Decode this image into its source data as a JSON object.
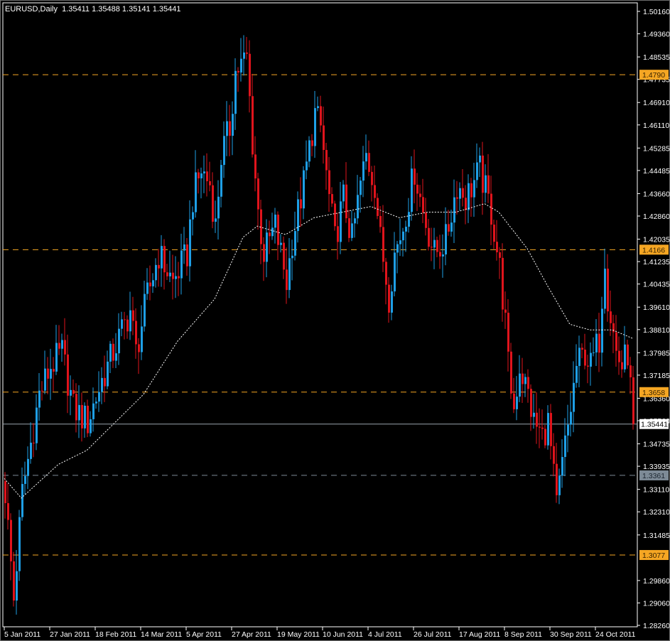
{
  "header": {
    "symbol_period": "EURUSD,Daily",
    "ohlc": "1.35411 1.35488 1.35141 1.35441"
  },
  "colors": {
    "background": "#000000",
    "bull": "#1e9fe6",
    "bear": "#e0141c",
    "grid_axis": "#ffffff",
    "level_orange": "#f5a623",
    "level_gray": "#7d8a96",
    "moving_average": "#ffffff"
  },
  "chart_data": {
    "type": "candlestick",
    "title": "EURUSD,Daily",
    "ylim": [
      1.2826,
      1.5016
    ],
    "y_ticks": [
      "1.50160",
      "1.49360",
      "1.48535",
      "1.47735",
      "1.46910",
      "1.46110",
      "1.45285",
      "1.44485",
      "1.43660",
      "1.42860",
      "1.42035",
      "1.41235",
      "1.40435",
      "1.39610",
      "1.38810",
      "1.37985",
      "1.37185",
      "1.36360",
      "1.35560",
      "1.34735",
      "1.33935",
      "1.33110",
      "1.32310",
      "1.31485",
      "1.29860",
      "1.29060",
      "1.28260"
    ],
    "x_ticks": [
      {
        "bar": 0,
        "label": "5 Jan 2011"
      },
      {
        "bar": 16,
        "label": "27 Jan 2011"
      },
      {
        "bar": 32,
        "label": "18 Feb 2011"
      },
      {
        "bar": 48,
        "label": "14 Mar 2011"
      },
      {
        "bar": 64,
        "label": "5 Apr 2011"
      },
      {
        "bar": 80,
        "label": "27 Apr 2011"
      },
      {
        "bar": 96,
        "label": "19 May 2011"
      },
      {
        "bar": 112,
        "label": "10 Jun 2011"
      },
      {
        "bar": 128,
        "label": "4 Jul 2011"
      },
      {
        "bar": 144,
        "label": "26 Jul 2011"
      },
      {
        "bar": 160,
        "label": "17 Aug 2011"
      },
      {
        "bar": 176,
        "label": "8 Sep 2011"
      },
      {
        "bar": 192,
        "label": "30 Sep 2011"
      },
      {
        "bar": 208,
        "label": "24 Oct 2011"
      }
    ],
    "bar_count": 222,
    "approx_close_path": [
      [
        0,
        1.33
      ],
      [
        3,
        1.292
      ],
      [
        6,
        1.33
      ],
      [
        12,
        1.365
      ],
      [
        16,
        1.375
      ],
      [
        20,
        1.38
      ],
      [
        24,
        1.36
      ],
      [
        29,
        1.355
      ],
      [
        34,
        1.37
      ],
      [
        40,
        1.385
      ],
      [
        44,
        1.395
      ],
      [
        46,
        1.38
      ],
      [
        50,
        1.4
      ],
      [
        54,
        1.415
      ],
      [
        59,
        1.405
      ],
      [
        64,
        1.415
      ],
      [
        66,
        1.435
      ],
      [
        69,
        1.445
      ],
      [
        72,
        1.44
      ],
      [
        74,
        1.425
      ],
      [
        76,
        1.45
      ],
      [
        79,
        1.46
      ],
      [
        81,
        1.48
      ],
      [
        85,
        1.485
      ],
      [
        87,
        1.455
      ],
      [
        89,
        1.43
      ],
      [
        91,
        1.415
      ],
      [
        95,
        1.425
      ],
      [
        99,
        1.405
      ],
      [
        101,
        1.42
      ],
      [
        105,
        1.44
      ],
      [
        109,
        1.465
      ],
      [
        111,
        1.46
      ],
      [
        114,
        1.435
      ],
      [
        116,
        1.42
      ],
      [
        119,
        1.435
      ],
      [
        122,
        1.42
      ],
      [
        125,
        1.44
      ],
      [
        127,
        1.45
      ],
      [
        130,
        1.44
      ],
      [
        132,
        1.42
      ],
      [
        135,
        1.4
      ],
      [
        137,
        1.415
      ],
      [
        140,
        1.425
      ],
      [
        144,
        1.445
      ],
      [
        147,
        1.43
      ],
      [
        151,
        1.415
      ],
      [
        155,
        1.42
      ],
      [
        159,
        1.44
      ],
      [
        162,
        1.435
      ],
      [
        167,
        1.445
      ],
      [
        171,
        1.43
      ],
      [
        174,
        1.41
      ],
      [
        176,
        1.39
      ],
      [
        177,
        1.375
      ],
      [
        179,
        1.36
      ],
      [
        181,
        1.375
      ],
      [
        184,
        1.365
      ],
      [
        186,
        1.355
      ],
      [
        189,
        1.35
      ],
      [
        191,
        1.355
      ],
      [
        194,
        1.325
      ],
      [
        196,
        1.34
      ],
      [
        199,
        1.36
      ],
      [
        201,
        1.375
      ],
      [
        204,
        1.38
      ],
      [
        206,
        1.375
      ],
      [
        209,
        1.385
      ],
      [
        211,
        1.415
      ],
      [
        212,
        1.4
      ],
      [
        215,
        1.38
      ],
      [
        217,
        1.375
      ],
      [
        219,
        1.38
      ],
      [
        221,
        1.3544
      ]
    ],
    "moving_average_path": [
      [
        0,
        1.335
      ],
      [
        6,
        1.328
      ],
      [
        19,
        1.34
      ],
      [
        29,
        1.345
      ],
      [
        39,
        1.355
      ],
      [
        49,
        1.365
      ],
      [
        61,
        1.384
      ],
      [
        74,
        1.399
      ],
      [
        84,
        1.421
      ],
      [
        89,
        1.425
      ],
      [
        99,
        1.422
      ],
      [
        109,
        1.428
      ],
      [
        119,
        1.43
      ],
      [
        129,
        1.432
      ],
      [
        139,
        1.428
      ],
      [
        149,
        1.43
      ],
      [
        159,
        1.43
      ],
      [
        169,
        1.433
      ],
      [
        174,
        1.43
      ],
      [
        184,
        1.417
      ],
      [
        191,
        1.404
      ],
      [
        199,
        1.39
      ],
      [
        206,
        1.388
      ],
      [
        214,
        1.388
      ],
      [
        221,
        1.385
      ]
    ],
    "levels": [
      {
        "value": 1.479,
        "label": "1.4790",
        "style": "orange"
      },
      {
        "value": 1.4166,
        "label": "1.4166",
        "style": "orange"
      },
      {
        "value": 1.3658,
        "label": "1.3658",
        "style": "orange"
      },
      {
        "value": 1.3361,
        "label": "1.3361",
        "style": "gray"
      },
      {
        "value": 1.3077,
        "label": "1.3077",
        "style": "orange"
      }
    ],
    "current_price": {
      "value": 1.35441,
      "label": "1.35441"
    }
  }
}
